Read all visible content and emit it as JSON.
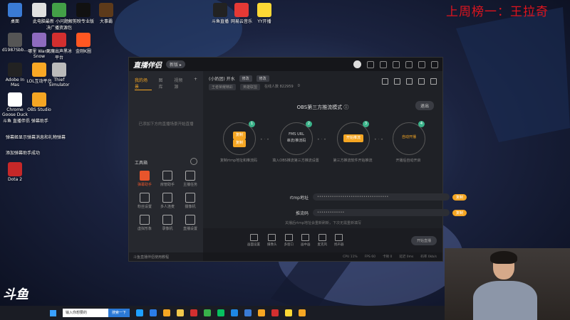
{
  "rank_banner": "上周榜一：王拉奇",
  "desktop_icons": [
    {
      "label": "桌面",
      "color": "#3a7bd5"
    },
    {
      "label": "此电脑",
      "color": "#e0e0e0"
    },
    {
      "label": "最新 小问题解决广播资源包",
      "color": "#43a047"
    },
    {
      "label": "剪映专业版",
      "color": "#111"
    },
    {
      "label": "大事霸",
      "color": "#5d3a1a"
    },
    {
      "label": "d1987Sbb...",
      "color": "#555"
    },
    {
      "label": "哪里 Warm Snow",
      "color": "#8e6bbf"
    },
    {
      "label": "死魔出声黑冰平台",
      "color": "#d32f2f"
    },
    {
      "label": "金刚K圈",
      "color": "#ff5722"
    },
    {
      "label": "Adobe In Mas",
      "color": "#222"
    },
    {
      "label": "LOL互动平台",
      "color": "#f9a825"
    },
    {
      "label": "Thief Simulator",
      "color": "#bbb"
    },
    {
      "label": "Chrome Goose Duck",
      "color": "#fff"
    },
    {
      "label": "OBS Studio",
      "color": "#f5a623"
    },
    {
      "label": "添加弹幕助手成功",
      "color": "#333"
    },
    {
      "label": "Dota 2",
      "color": "#c62828"
    },
    {
      "label": "斗鱼直播",
      "color": "#222"
    },
    {
      "label": "网易云音乐",
      "color": "#e53935"
    },
    {
      "label": "YY开播",
      "color": "#fdd835"
    }
  ],
  "desktop_notes": [
    "斗鱼 直播伴侣 弹幕助手",
    "弹幕姬显示弹幕消息和礼物弹幕"
  ],
  "app": {
    "title": "直播伴侣",
    "version_pill": "新版 ▸",
    "sidebar": {
      "tabs": [
        "我的场景",
        "图库",
        "视频源"
      ],
      "add": "+",
      "empty_hint": "已添加下方的直播场景开始直播",
      "tools_title": "工具箱",
      "tools": [
        {
          "label": "弹幕助手",
          "active": true
        },
        {
          "label": "房管助手",
          "active": false
        },
        {
          "label": "主播任务",
          "active": false
        },
        {
          "label": "粉丝设置",
          "active": false
        },
        {
          "label": "多人连麦",
          "active": false
        },
        {
          "label": "摄像机",
          "active": false
        },
        {
          "label": "虚拟形象",
          "active": false
        },
        {
          "label": "录像机",
          "active": false
        },
        {
          "label": "直播设置",
          "active": false
        }
      ],
      "footer": "斗鱼直播伴侣使用教程"
    },
    "stream_info": {
      "room_title": "(小奶团) 开水",
      "chip1": "修改",
      "chip2": "修改",
      "tag1": "王者荣耀精彩",
      "tag2": "英雄联盟",
      "viewers": "在线人数 822959",
      "hot": "0"
    },
    "obs_title": "OBS第三方推流模式 ⓘ",
    "exit_button": "退出",
    "steps": [
      {
        "num": "1",
        "line1": "复制",
        "line2": "复制",
        "desc": "复制rtmp地址和推流码"
      },
      {
        "num": "2",
        "line1": "FMS URL",
        "line2": "串流/推流码",
        "desc": "填入OBS推流第三方推流设置"
      },
      {
        "num": "3",
        "line1": "开始推流",
        "line2": "",
        "desc": "第三方推流软件开始推流"
      },
      {
        "num": "4",
        "line1": "自动开播",
        "line2": "",
        "desc": "开播后自动开启"
      }
    ],
    "rtmp": {
      "label": "rtmp地址",
      "value": "••••••••••••••••••••••••••••••••••",
      "copy": "复制"
    },
    "code": {
      "label": "推流码",
      "value": "•••••••••••••",
      "copy": "复制"
    },
    "field_note": "关播后rtmp地址会重新刷新，下次无需重新填写",
    "bottom_tools": [
      "画面设置",
      "摄像头",
      "多窗口",
      "画中画",
      "麦克风",
      "扬声器"
    ],
    "start_button": "开始直播",
    "status": [
      "CPU 11%",
      "FPS 60",
      "卡顿 0",
      "延迟 0ms",
      "码率 0kb/s"
    ]
  },
  "taskbar": {
    "douyu": "斗鱼",
    "search_placeholder": "输入你想要的",
    "search_btn": "搜索一下",
    "apps": [
      "#1ea0ff",
      "#2b7de9",
      "#f5a623",
      "#f2c94c",
      "#d32f2f",
      "#38b24a",
      "#07c160",
      "#1e88e5",
      "#3a7bd5",
      "#f5a623",
      "#d32f2f",
      "#fdd835",
      "#f5a623"
    ]
  }
}
